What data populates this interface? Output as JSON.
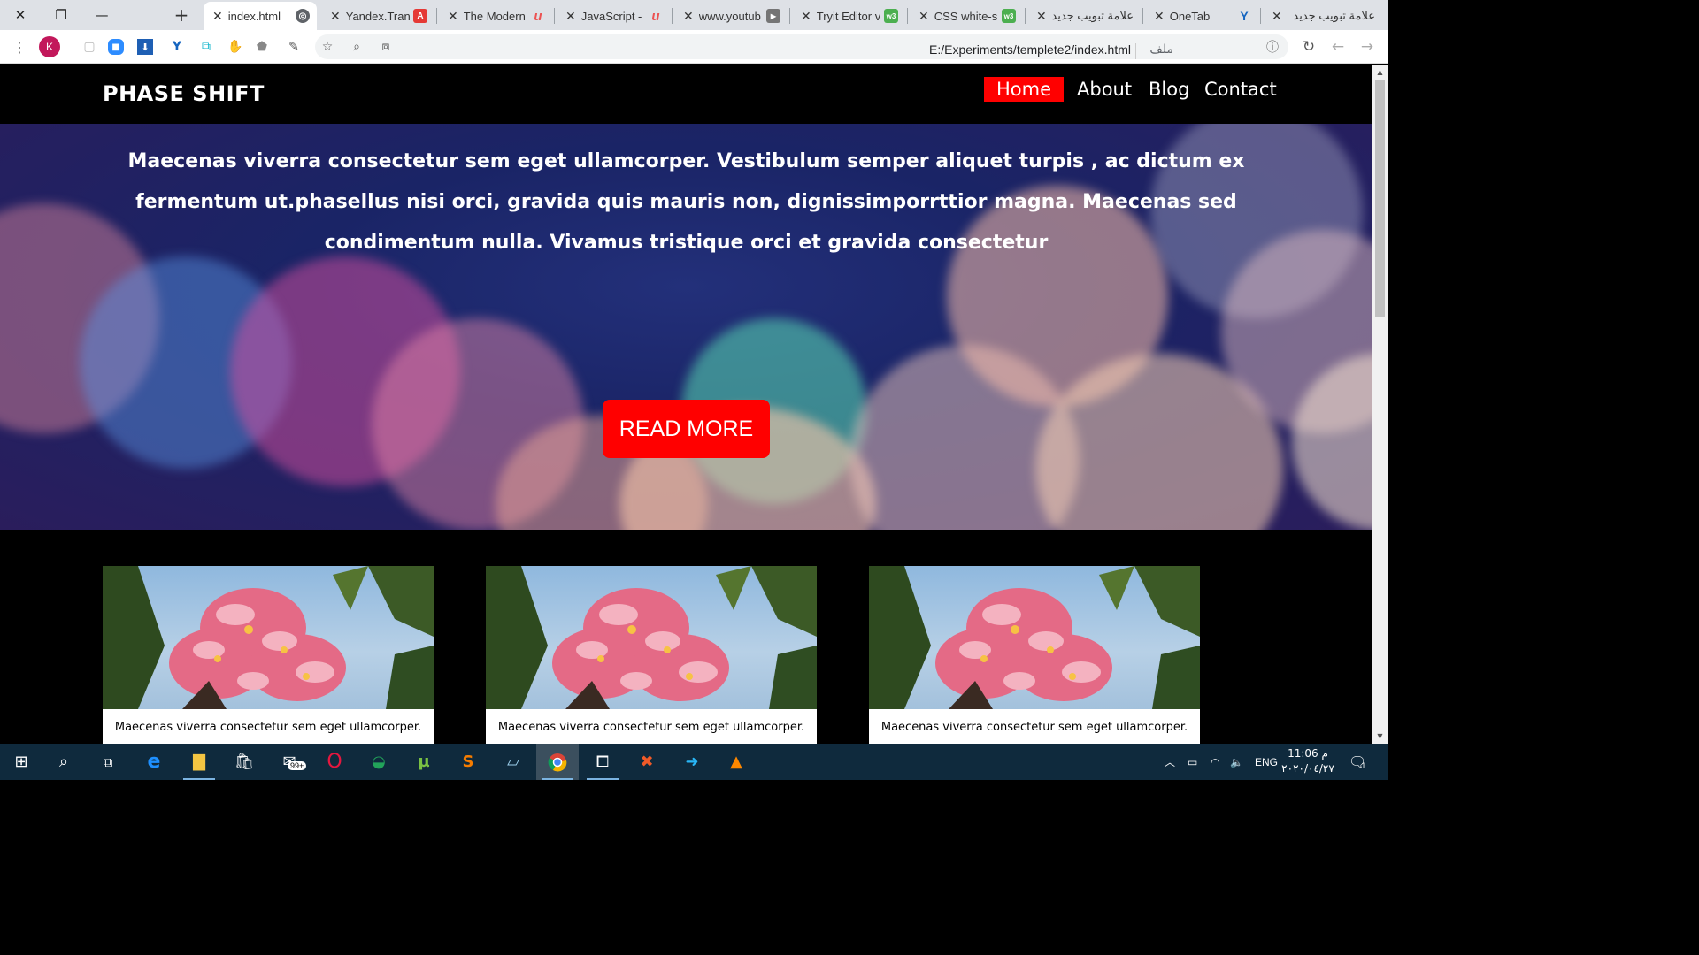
{
  "browser": {
    "tabs": [
      {
        "title": "index.html",
        "favicon": "globe-icon",
        "active": true
      },
      {
        "title": "Yandex.Trans",
        "favicon": "translate-icon"
      },
      {
        "title": "The Modern",
        "favicon": "udemy-icon"
      },
      {
        "title": "JavaScript -",
        "favicon": "udemy-icon"
      },
      {
        "title": "www.youtub",
        "favicon": "youtube-icon"
      },
      {
        "title": "Tryit Editor v",
        "favicon": "w3schools-icon"
      },
      {
        "title": "CSS white-s",
        "favicon": "w3schools-icon"
      },
      {
        "title": "علامة تبويب جديد",
        "favicon": "newtab-icon"
      },
      {
        "title": "OneTab",
        "favicon": "onetab-icon"
      },
      {
        "title": "علامة تبويب جديد",
        "favicon": "newtab-icon"
      }
    ],
    "new_tab": "+",
    "profile_initial": "K",
    "url": "E:/Experiments/templete2/index.html",
    "url_scheme_label": "ملف"
  },
  "site": {
    "brand": "PHASE SHIFT",
    "nav": [
      "Home",
      "About",
      "Blog",
      "Contact"
    ],
    "active_nav": "Home",
    "hero_text": "Maecenas viverra consectetur sem eget ullamcorper. Vestibulum semper aliquet turpis , ac dictum ex fermentum ut.phasellus nisi orci, gravida quis mauris non, dignissimporrttior magna. Maecenas sed condimentum nulla. Vivamus tristique orci et gravida consectetur",
    "cta": "READ MORE",
    "cards": [
      {
        "caption": "Maecenas viverra consectetur sem eget ullamcorper."
      },
      {
        "caption": "Maecenas viverra consectetur sem eget ullamcorper."
      },
      {
        "caption": "Maecenas viverra consectetur sem eget ullamcorper."
      }
    ]
  },
  "taskbar": {
    "mail_badge": "99+",
    "language": "ENG",
    "time": "11:06 م",
    "date": "٢٠٢٠/٠٤/٢٧",
    "notification_count": "1"
  },
  "colors": {
    "accent": "#ff0000",
    "nav_bg": "#000000",
    "taskbar": "#0f2a3d"
  }
}
